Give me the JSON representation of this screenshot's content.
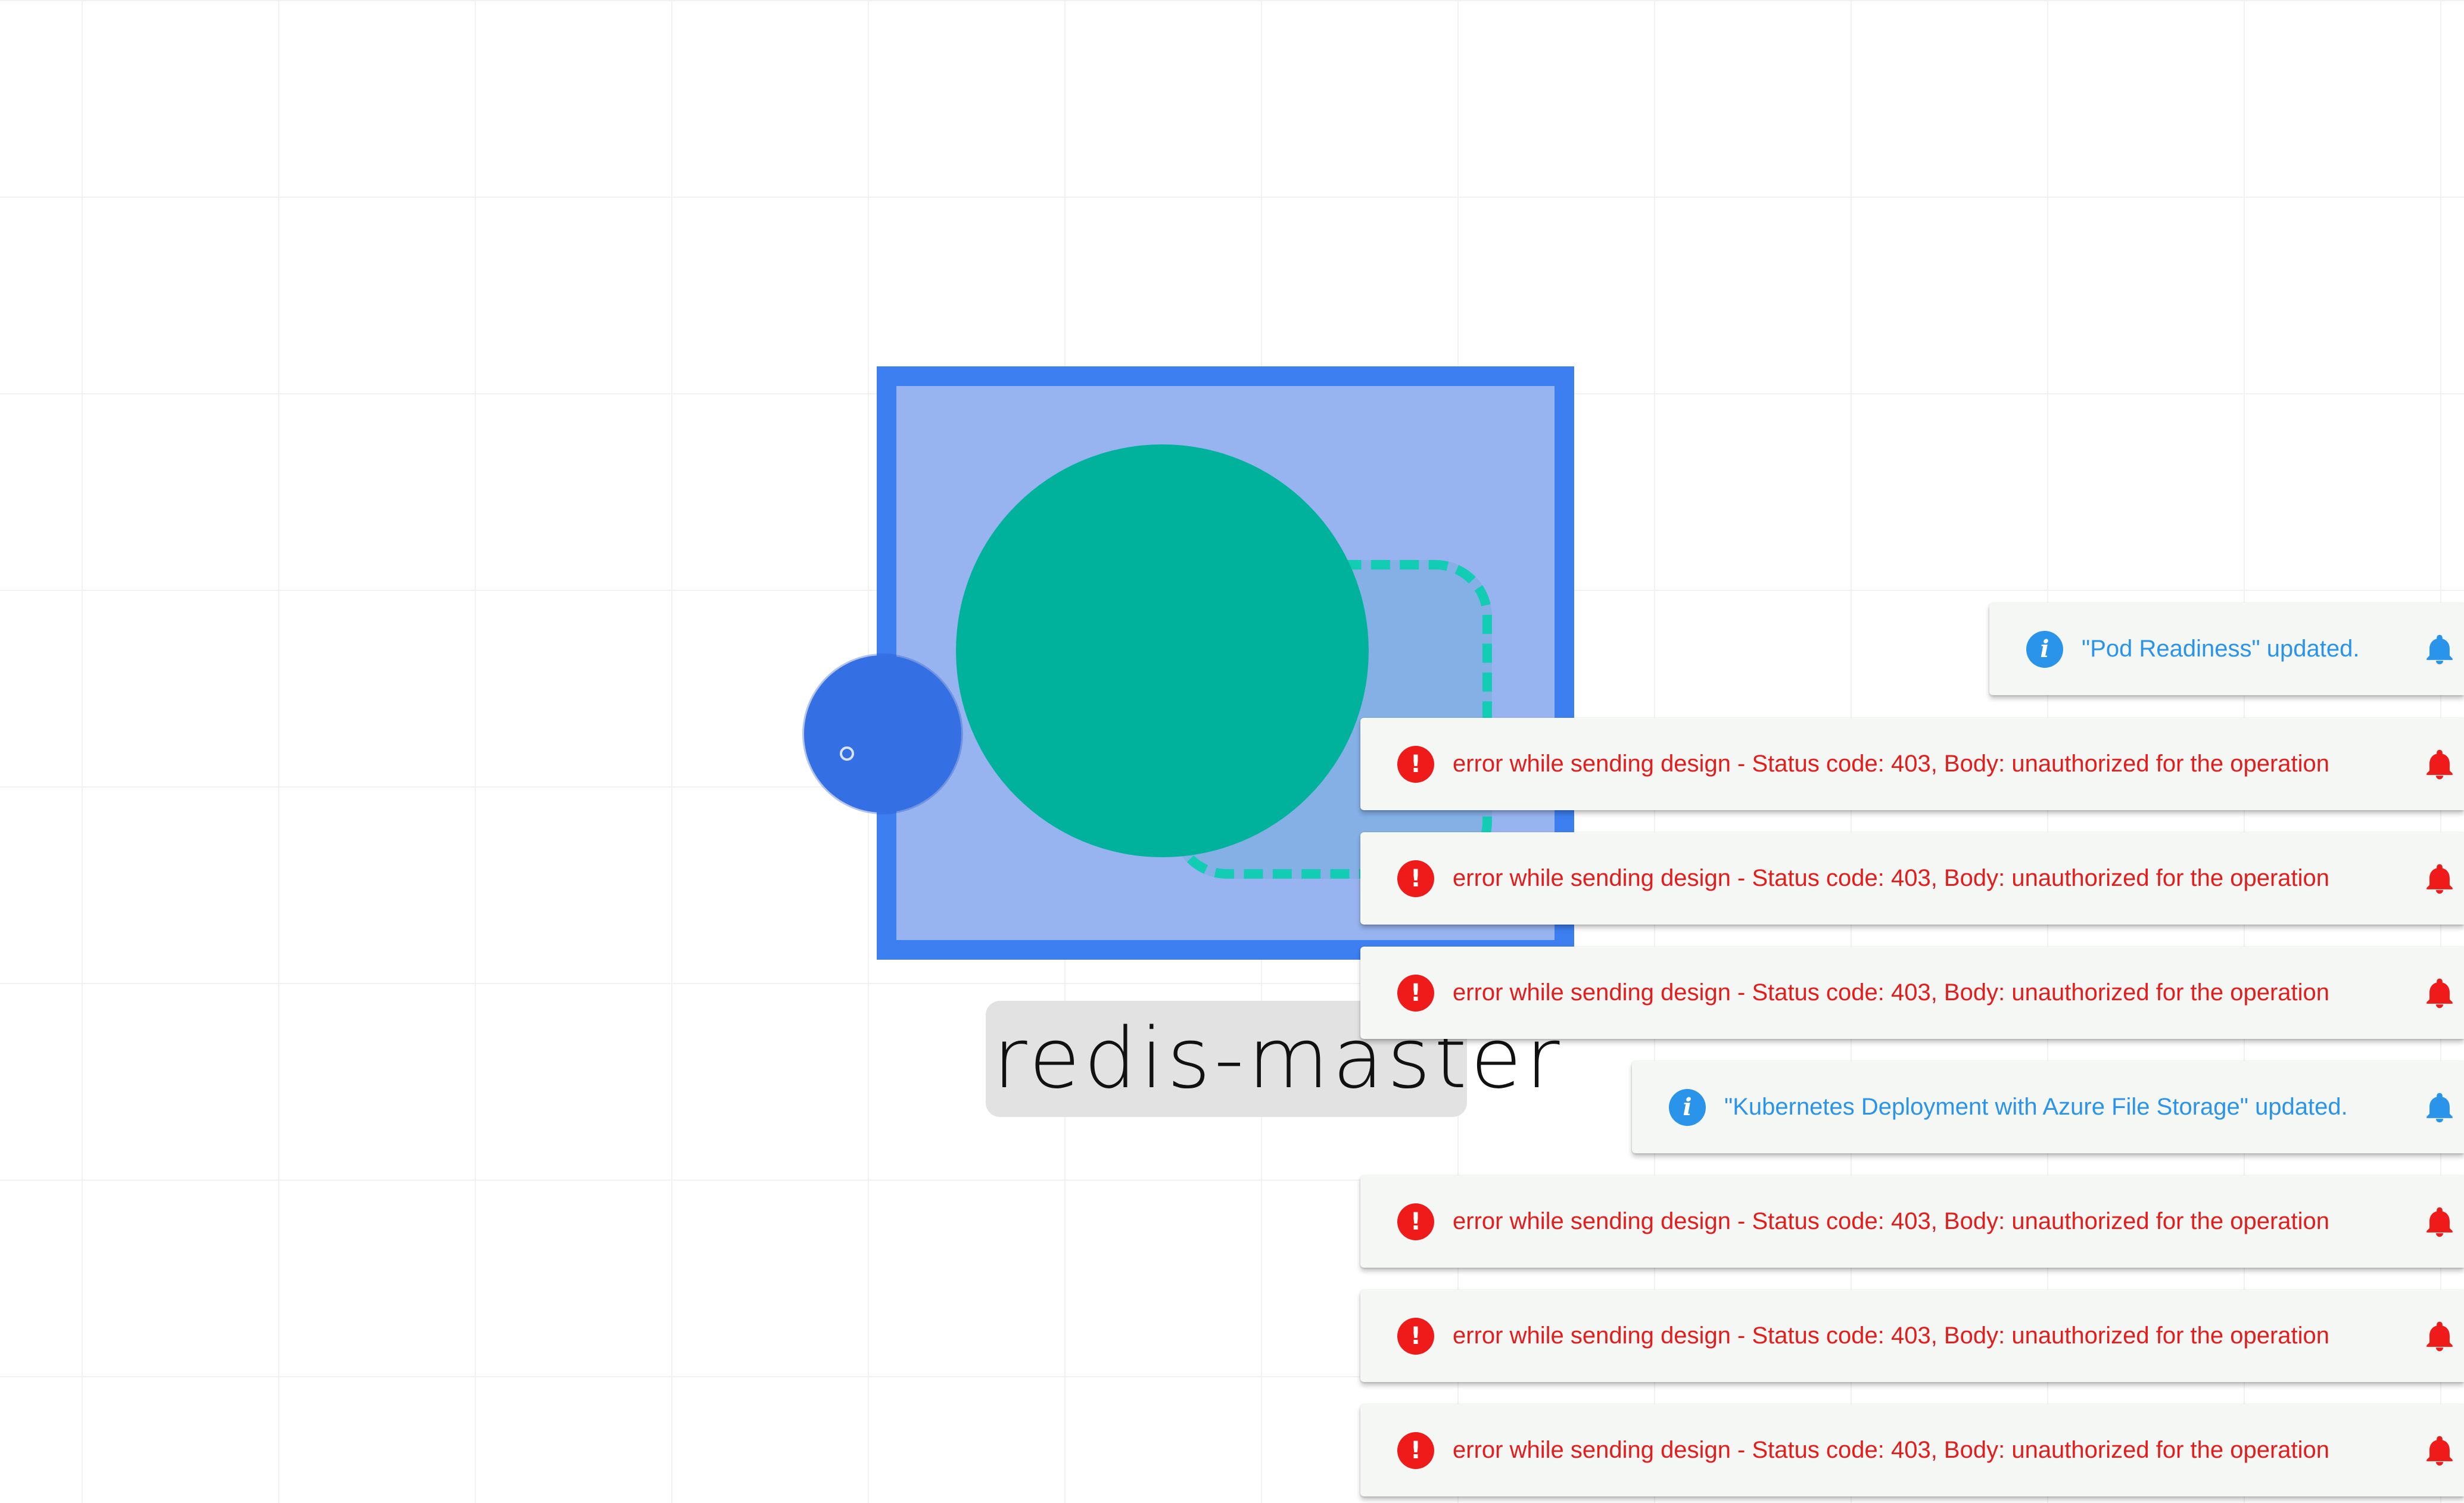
{
  "canvas": {
    "node": {
      "label": "redis-master",
      "colors": {
        "frame_border": "#3d7ef0",
        "frame_fill": "#98b4f0",
        "circle": "#00b29c",
        "dashed_outline": "#12cdb4",
        "handle": "#346fe4",
        "label_background": "#e1e2e1"
      }
    }
  },
  "notifications": [
    {
      "type": "info",
      "icon": "info-icon",
      "message": "\"Pod Readiness\" updated.",
      "color": "#2a93ea"
    },
    {
      "type": "error",
      "icon": "error-icon",
      "message": "error while sending design - Status code: 403, Body: unauthorized for the operation",
      "color": "#e51c1c"
    },
    {
      "type": "error",
      "icon": "error-icon",
      "message": "error while sending design - Status code: 403, Body: unauthorized for the operation",
      "color": "#e51c1c"
    },
    {
      "type": "error",
      "icon": "error-icon",
      "message": "error while sending design - Status code: 403, Body: unauthorized for the operation",
      "color": "#e51c1c"
    },
    {
      "type": "info",
      "icon": "info-icon",
      "message": "\"Kubernetes Deployment with Azure File Storage\" updated.",
      "color": "#2a93ea"
    },
    {
      "type": "error",
      "icon": "error-icon",
      "message": "error while sending design - Status code: 403, Body: unauthorized for the operation",
      "color": "#e51c1c"
    },
    {
      "type": "error",
      "icon": "error-icon",
      "message": "error while sending design - Status code: 403, Body: unauthorized for the operation",
      "color": "#e51c1c"
    },
    {
      "type": "error",
      "icon": "error-icon",
      "message": "error while sending design - Status code: 403, Body: unauthorized for the operation",
      "color": "#e51c1c"
    }
  ]
}
